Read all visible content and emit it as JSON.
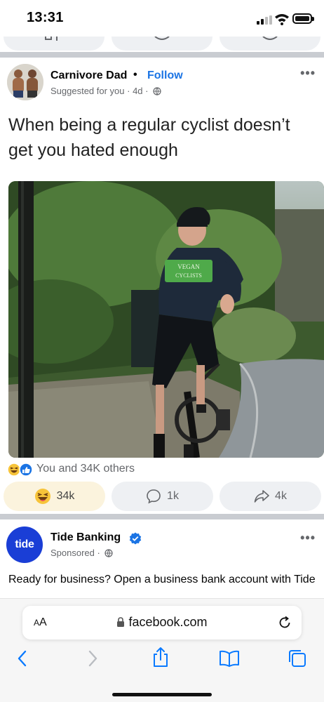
{
  "status_bar": {
    "time": "13:31",
    "signal_bars_filled": 2,
    "battery_level": 0.85
  },
  "post": {
    "author": "Carnivore Dad",
    "separator": "•",
    "follow_label": "Follow",
    "meta": "Suggested for you · 4d ·",
    "more_label": "•••",
    "meme_text": "When being a regular cyclist doesn’t get you hated enough",
    "jersey_text_1": "VEGAN",
    "jersey_text_2": "CYCLISTS",
    "reactions_text": "You and 34K others",
    "actions": {
      "react_count": "34k",
      "comment_count": "1k",
      "share_count": "4k"
    }
  },
  "ad": {
    "logo_text": "tide",
    "name": "Tide Banking",
    "meta": "Sponsored ·",
    "more_label": "•••",
    "body": "Ready for business? Open a business bank account with Tide"
  },
  "browser": {
    "aa_label_big": "A",
    "aa_label_small": "A",
    "url": "facebook.com"
  },
  "colors": {
    "facebook_blue": "#1b74e4",
    "separator_gray": "#c9ccd1",
    "tide_blue": "#1a3ed6",
    "safari_blue": "#0a7aff",
    "active_react_bg": "#fbf3dd"
  },
  "icons": [
    "signal-icon",
    "wifi-icon",
    "battery-icon",
    "globe-icon",
    "haha-icon",
    "like-icon",
    "comment-icon",
    "share-icon",
    "verified-icon",
    "lock-icon",
    "reload-icon",
    "back-icon",
    "forward-icon",
    "share-sheet-icon",
    "bookmarks-icon",
    "tabs-icon"
  ]
}
